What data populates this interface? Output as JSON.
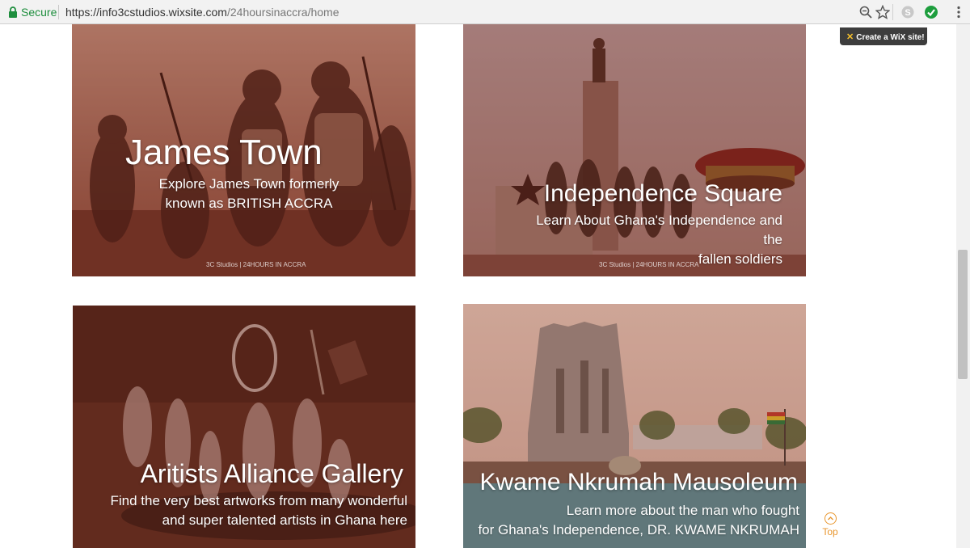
{
  "browser": {
    "secure_label": "Secure",
    "url_host": "https://info3cstudios.wixsite.com",
    "url_path": "/24hoursinaccra/home"
  },
  "wix_badge": {
    "label": "Create a WiX site!"
  },
  "cards": [
    {
      "title": "James Town",
      "desc_line1": "Explore James Town formerly",
      "desc_line2": "known as BRITISH ACCRA",
      "watermark": "3C Studios | 24HOURS IN ACCRA"
    },
    {
      "title": "Independence Square",
      "desc_line1": "Learn About Ghana's Independence and the",
      "desc_line2": "fallen soldiers",
      "watermark": "3C Studios | 24HOURS IN ACCRA"
    },
    {
      "title": "Aritists Alliance Gallery",
      "desc_line1": "Find the very best artworks from many wonderful",
      "desc_line2": "and super talented artists in Ghana here"
    },
    {
      "title": "Kwame Nkrumah Mausoleum",
      "desc_line1": "Learn more about the man who fought",
      "desc_line2": "for Ghana's Independence, DR. KWAME NKRUMAH"
    }
  ],
  "top_button": {
    "label": "Top"
  },
  "colors": {
    "tint": "#7a2e22",
    "accent": "#e8962e",
    "secure_green": "#1e8e3e"
  }
}
